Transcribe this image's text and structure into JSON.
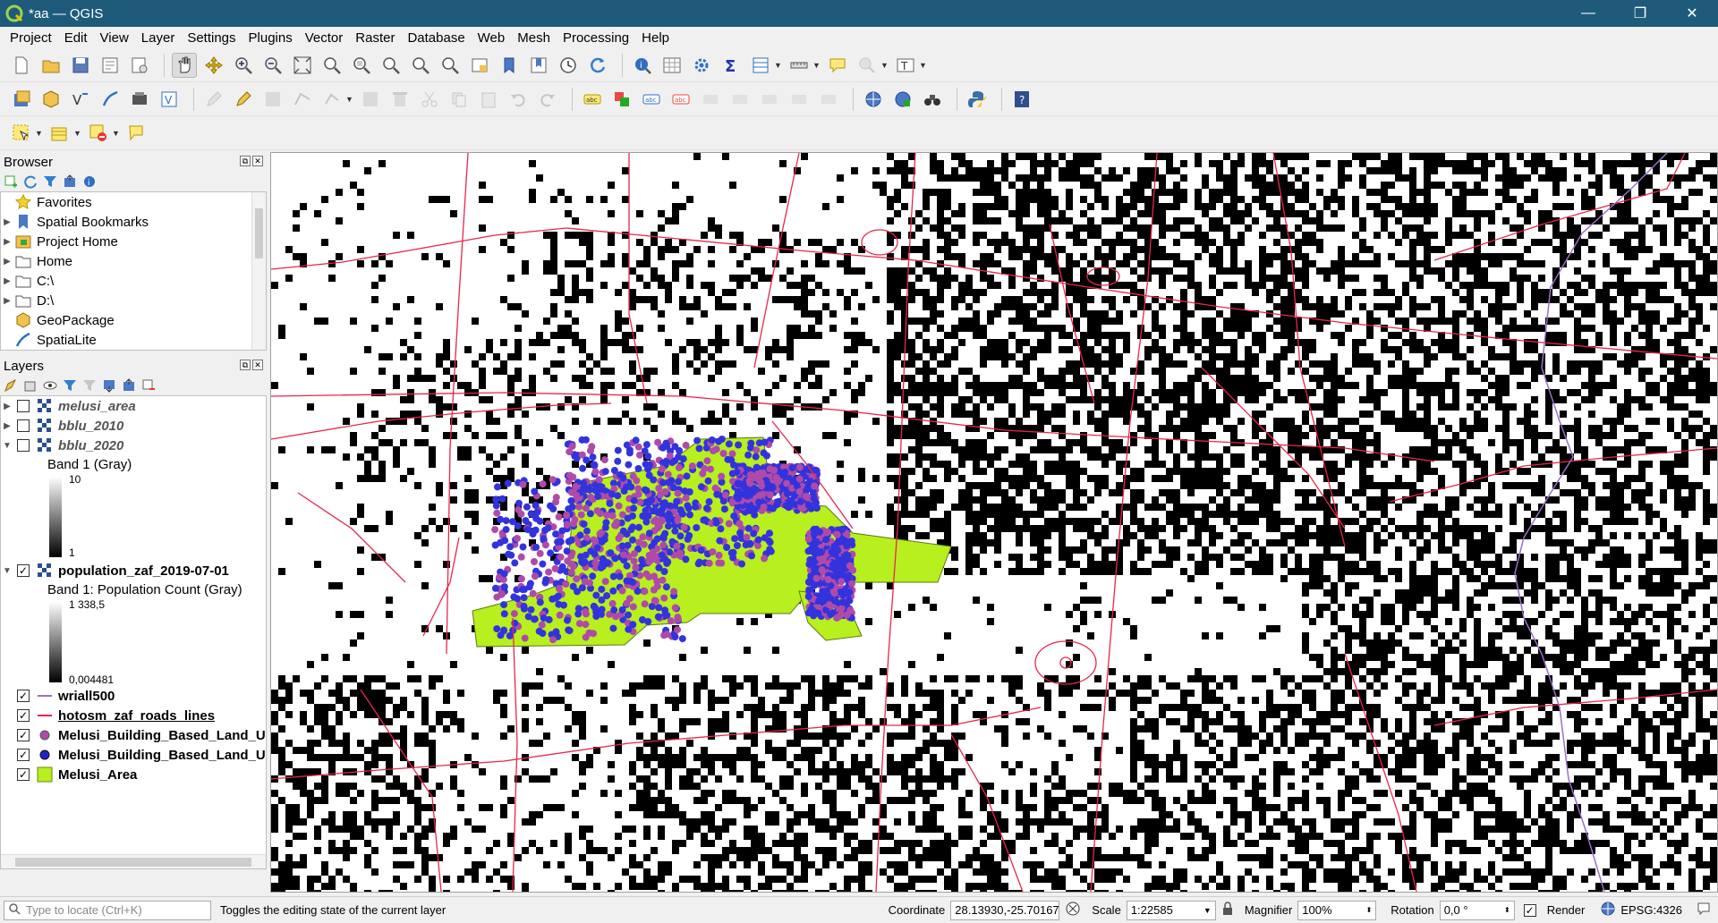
{
  "window": {
    "title": "*aa — QGIS",
    "controls": [
      "—",
      "❐",
      "✕"
    ]
  },
  "menu": [
    "Project",
    "Edit",
    "View",
    "Layer",
    "Settings",
    "Plugins",
    "Vector",
    "Raster",
    "Database",
    "Web",
    "Mesh",
    "Processing",
    "Help"
  ],
  "browser": {
    "title": "Browser",
    "items": [
      {
        "label": "Favorites",
        "icon": "star-icon"
      },
      {
        "label": "Spatial Bookmarks",
        "icon": "bookmark-icon"
      },
      {
        "label": "Project Home",
        "icon": "project-home-icon"
      },
      {
        "label": "Home",
        "icon": "folder-icon"
      },
      {
        "label": "C:\\",
        "icon": "folder-icon"
      },
      {
        "label": "D:\\",
        "icon": "folder-icon"
      },
      {
        "label": "GeoPackage",
        "icon": "geopackage-icon"
      },
      {
        "label": "SpatiaLite",
        "icon": "spatialite-icon"
      }
    ]
  },
  "layers": {
    "title": "Layers",
    "items": [
      {
        "name": "melusi_area",
        "checked": false,
        "style": "italic",
        "icon": "raster-icon"
      },
      {
        "name": "bblu_2010",
        "checked": false,
        "style": "italic",
        "icon": "raster-icon"
      },
      {
        "name": "bblu_2020",
        "checked": false,
        "style": "italic",
        "icon": "raster-icon"
      },
      {
        "name": "population_zaf_2019-07-01",
        "checked": true,
        "style": "bold",
        "icon": "raster-icon"
      },
      {
        "name": "wriall500",
        "checked": true,
        "style": "bold",
        "icon": "line-purple-icon"
      },
      {
        "name": "hotosm_zaf_roads_lines",
        "checked": true,
        "style": "bold-underline",
        "icon": "line-red-icon"
      },
      {
        "name": "Melusi_Building_Based_Land_U",
        "checked": true,
        "style": "bold",
        "icon": "point-purple-icon"
      },
      {
        "name": "Melusi_Building_Based_Land_U",
        "checked": true,
        "style": "bold",
        "icon": "point-blue-icon"
      },
      {
        "name": "Melusi_Area",
        "checked": true,
        "style": "bold",
        "icon": "polygon-green-icon"
      }
    ],
    "bblu_band": "Band 1 (Gray)",
    "bblu_max": "10",
    "bblu_min": "1",
    "pop_band": "Band 1: Population Count (Gray)",
    "pop_max": "1 338,5",
    "pop_min": "0,004481"
  },
  "status": {
    "locate_placeholder": "Type to locate (Ctrl+K)",
    "message": "Toggles the editing state of the current layer",
    "coordinate_label": "Coordinate",
    "coordinate": "28.13930,-25.70167",
    "scale_label": "Scale",
    "scale": "1:22585",
    "magnifier_label": "Magnifier",
    "magnifier": "100%",
    "rotation_label": "Rotation",
    "rotation": "0,0 °",
    "render_label": "Render",
    "crs": "EPSG:4326"
  },
  "colors": {
    "titlebar": "#1e5b7b",
    "road": "#e8264a",
    "melusi_area": "#b7ef1f",
    "buildings_blue": "#3333dd",
    "buildings_purple": "#b04aa8",
    "river": "#9a6fc7"
  }
}
